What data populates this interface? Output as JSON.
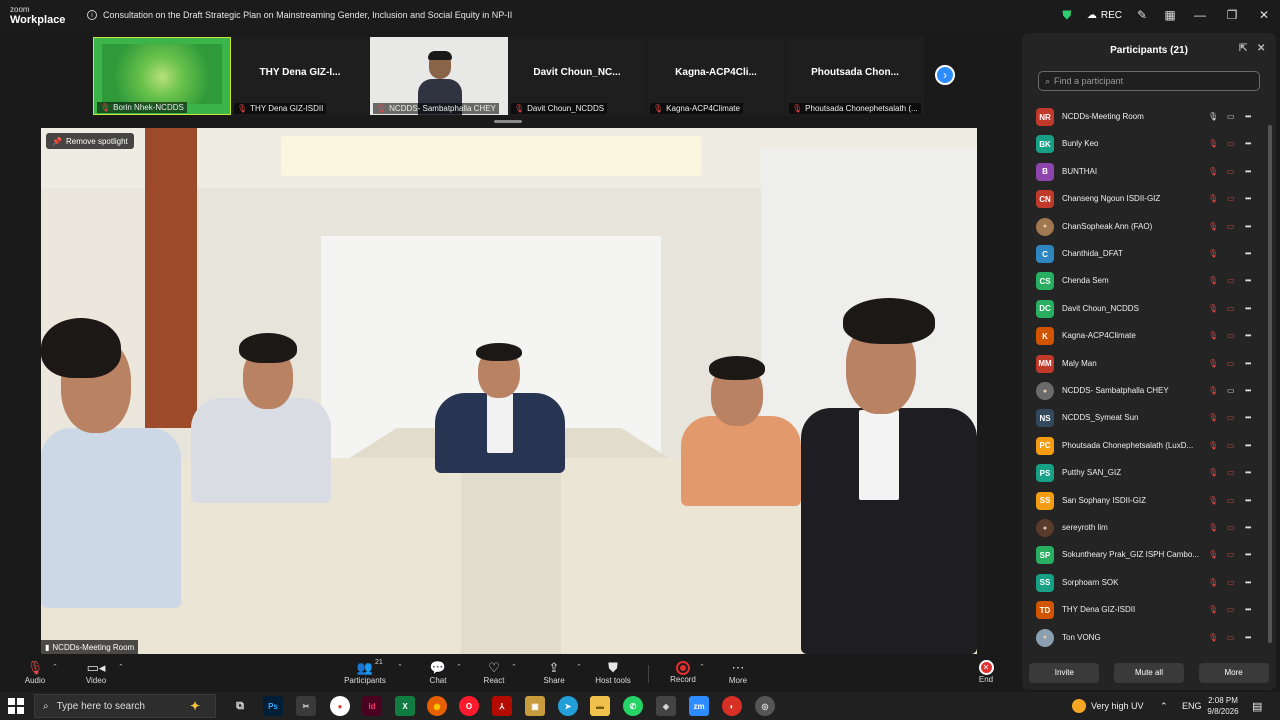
{
  "window": {
    "logo_line1": "zoom",
    "logo_line2": "Workplace",
    "meeting_title": "Consultation on the Draft Strategic Plan on Mainstreaming Gender, Inclusion and Social Equity in NP-II",
    "rec_label": "REC"
  },
  "thumbnails": [
    {
      "name": "",
      "label": "Borin Nhek-NCDDS",
      "kind": "screen"
    },
    {
      "name": "THY Dena GIZ-I...",
      "label": "THY Dena GIZ-ISDII",
      "kind": "name"
    },
    {
      "name": "",
      "label": "NCDDS- Sambatphalla CHEY",
      "kind": "camera"
    },
    {
      "name": "Davit Choun_NC...",
      "label": "Davit Choun_NCDDS",
      "kind": "name"
    },
    {
      "name": "Kagna-ACP4Cli...",
      "label": "Kagna-ACP4Climate",
      "kind": "name"
    },
    {
      "name": "Phoutsada Chon...",
      "label": "Phoutsada Chonephetsalath (...",
      "kind": "name"
    }
  ],
  "main_video": {
    "spotlight_button": "Remove spotlight",
    "label": "NCDDs-Meeting Room"
  },
  "participants_panel": {
    "title": "Participants (21)",
    "search_placeholder": "Find a participant",
    "participants": [
      {
        "initials": "NR",
        "name": "NCDDs-Meeting Room",
        "color": "#c0392b",
        "mic": "on",
        "cam": "on"
      },
      {
        "initials": "BK",
        "name": "Bunly Keo",
        "color": "#16a085",
        "mic": "off",
        "cam": "off"
      },
      {
        "initials": "B",
        "name": "BUNTHAI",
        "color": "#8e44ad",
        "mic": "off",
        "cam": "off"
      },
      {
        "initials": "CN",
        "name": "Chanseng Ngoun ISDII-GIZ",
        "color": "#c0392b",
        "mic": "off",
        "cam": "off"
      },
      {
        "initials": "",
        "name": "ChanSopheak Ann (FAO)",
        "color": "#a07850",
        "mic": "off",
        "cam": "off"
      },
      {
        "initials": "C",
        "name": "Chanthida_DFAT",
        "color": "#2e86c1",
        "mic": "off",
        "cam": "none"
      },
      {
        "initials": "CS",
        "name": "Chenda Sem",
        "color": "#27ae60",
        "mic": "off",
        "cam": "off"
      },
      {
        "initials": "DC",
        "name": "Davit Choun_NCDDS",
        "color": "#27ae60",
        "mic": "off",
        "cam": "off"
      },
      {
        "initials": "K",
        "name": "Kagna-ACP4Climate",
        "color": "#d35400",
        "mic": "off",
        "cam": "off"
      },
      {
        "initials": "MM",
        "name": "Maly Man",
        "color": "#c0392b",
        "mic": "off",
        "cam": "off"
      },
      {
        "initials": "",
        "name": "NCDDS- Sambatphalla CHEY",
        "color": "#6b6b6b",
        "mic": "off",
        "cam": "on"
      },
      {
        "initials": "NS",
        "name": "NCDDS_Symeat Sun",
        "color": "#34495e",
        "mic": "off",
        "cam": "off"
      },
      {
        "initials": "PC",
        "name": "Phoutsada Chonephetsalath (LuxD...",
        "color": "#f39c12",
        "mic": "off",
        "cam": "off"
      },
      {
        "initials": "PS",
        "name": "Putthy SAN_GIZ",
        "color": "#16a085",
        "mic": "off",
        "cam": "off"
      },
      {
        "initials": "SS",
        "name": "San Sophany ISDII-GIZ",
        "color": "#f39c12",
        "mic": "off",
        "cam": "off"
      },
      {
        "initials": "",
        "name": "sereyroth lim",
        "color": "#5a3a2a",
        "mic": "off",
        "cam": "off"
      },
      {
        "initials": "SP",
        "name": "Sokuntheary Prak_GIZ ISPH Cambo...",
        "color": "#27ae60",
        "mic": "off",
        "cam": "off"
      },
      {
        "initials": "SS",
        "name": "Sorphoarn SOK",
        "color": "#16a085",
        "mic": "off",
        "cam": "off"
      },
      {
        "initials": "TD",
        "name": "THY Dena GIZ-ISDII",
        "color": "#d35400",
        "mic": "off",
        "cam": "off"
      },
      {
        "initials": "",
        "name": "Ton VONG",
        "color": "#8aa0b0",
        "mic": "off",
        "cam": "off"
      }
    ],
    "footer": {
      "invite": "Invite",
      "mute_all": "Mute all",
      "more": "More"
    }
  },
  "toolbar": {
    "audio": "Audio",
    "video": "Video",
    "participants": "Participants",
    "participant_count": "21",
    "chat": "Chat",
    "react": "React",
    "share": "Share",
    "host_tools": "Host tools",
    "record": "Record",
    "more": "More",
    "end": "End"
  },
  "taskbar": {
    "search_placeholder": "Type here to search",
    "weather": "Very high UV",
    "language": "ENG",
    "time": "2:08 PM",
    "date": "9/8/2026",
    "apps": [
      {
        "label": "Ps",
        "bg": "#001e36",
        "fg": "#31a8ff"
      },
      {
        "label": "Id",
        "bg": "#49021f",
        "fg": "#ff3366"
      },
      {
        "label": "X",
        "bg": "#107c41",
        "fg": "#ffffff"
      },
      {
        "label": "zm",
        "bg": "#2d8cff",
        "fg": "#ffffff"
      }
    ]
  }
}
